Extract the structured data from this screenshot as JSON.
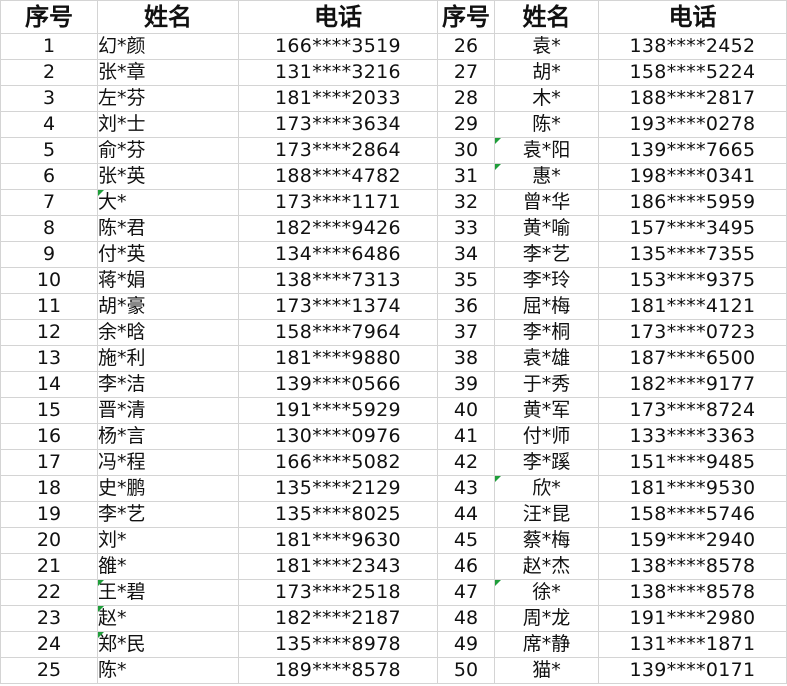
{
  "headers": [
    "序号",
    "姓名",
    "电话",
    "序号",
    "姓名",
    "电话"
  ],
  "left": [
    {
      "no": "1",
      "name": "幻*颜",
      "phone": "166****3519"
    },
    {
      "no": "2",
      "name": "张*章",
      "phone": "131****3216"
    },
    {
      "no": "3",
      "name": "左*芬",
      "phone": "181****2033"
    },
    {
      "no": "4",
      "name": "刘*士",
      "phone": "173****3634"
    },
    {
      "no": "5",
      "name": "俞*芬",
      "phone": "173****2864"
    },
    {
      "no": "6",
      "name": "张*英",
      "phone": "188****4782"
    },
    {
      "no": "7",
      "name": "大*",
      "phone": "173****1171"
    },
    {
      "no": "8",
      "name": "陈*君",
      "phone": "182****9426"
    },
    {
      "no": "9",
      "name": "付*英",
      "phone": "134****6486"
    },
    {
      "no": "10",
      "name": "蒋*娟",
      "phone": "138****7313"
    },
    {
      "no": "11",
      "name": "胡*豪",
      "phone": "173****1374"
    },
    {
      "no": "12",
      "name": "余*晗",
      "phone": "158****7964"
    },
    {
      "no": "13",
      "name": "施*利",
      "phone": "181****9880"
    },
    {
      "no": "14",
      "name": "李*洁",
      "phone": "139****0566"
    },
    {
      "no": "15",
      "name": "晋*清",
      "phone": "191****5929"
    },
    {
      "no": "16",
      "name": "杨*言",
      "phone": "130****0976"
    },
    {
      "no": "17",
      "name": "冯*程",
      "phone": "166****5082"
    },
    {
      "no": "18",
      "name": "史*鹏",
      "phone": "135****2129"
    },
    {
      "no": "19",
      "name": "李*艺",
      "phone": "135****8025"
    },
    {
      "no": "20",
      "name": "刘*",
      "phone": "181****9630"
    },
    {
      "no": "21",
      "name": "雒*",
      "phone": "181****2343"
    },
    {
      "no": "22",
      "name": "王*碧",
      "phone": "173****2518"
    },
    {
      "no": "23",
      "name": "赵*",
      "phone": "182****2187"
    },
    {
      "no": "24",
      "name": "郑*民",
      "phone": "135****8978"
    },
    {
      "no": "25",
      "name": "陈*",
      "phone": "189****8578"
    }
  ],
  "right": [
    {
      "no": "26",
      "name": "袁*",
      "phone": "138****2452"
    },
    {
      "no": "27",
      "name": "胡*",
      "phone": "158****5224"
    },
    {
      "no": "28",
      "name": "木*",
      "phone": "188****2817"
    },
    {
      "no": "29",
      "name": "陈*",
      "phone": "193****0278"
    },
    {
      "no": "30",
      "name": "袁*阳",
      "phone": "139****7665"
    },
    {
      "no": "31",
      "name": "惠*",
      "phone": "198****0341"
    },
    {
      "no": "32",
      "name": "曾*华",
      "phone": "186****5959"
    },
    {
      "no": "33",
      "name": "黄*喻",
      "phone": "157****3495"
    },
    {
      "no": "34",
      "name": "李*艺",
      "phone": "135****7355"
    },
    {
      "no": "35",
      "name": "李*玲",
      "phone": "153****9375"
    },
    {
      "no": "36",
      "name": "屈*梅",
      "phone": "181****4121"
    },
    {
      "no": "37",
      "name": "李*桐",
      "phone": "173****0723"
    },
    {
      "no": "38",
      "name": "袁*雄",
      "phone": "187****6500"
    },
    {
      "no": "39",
      "name": "于*秀",
      "phone": "182****9177"
    },
    {
      "no": "40",
      "name": "黄*军",
      "phone": "173****8724"
    },
    {
      "no": "41",
      "name": "付*师",
      "phone": "133****3363"
    },
    {
      "no": "42",
      "name": "李*蹊",
      "phone": "151****9485"
    },
    {
      "no": "43",
      "name": "欣*",
      "phone": "181****9530"
    },
    {
      "no": "44",
      "name": "汪*昆",
      "phone": "158****5746"
    },
    {
      "no": "45",
      "name": "蔡*梅",
      "phone": "159****2940"
    },
    {
      "no": "46",
      "name": "赵*杰",
      "phone": "138****8578"
    },
    {
      "no": "47",
      "name": "徐*",
      "phone": "138****8578"
    },
    {
      "no": "48",
      "name": "周*龙",
      "phone": "191****2980"
    },
    {
      "no": "49",
      "name": "席*静",
      "phone": "131****1871"
    },
    {
      "no": "50",
      "name": "猫*",
      "phone": "139****0171"
    }
  ],
  "colors": {
    "grid": "#d4d4d4",
    "comment_marker": "#1f9e3a"
  }
}
